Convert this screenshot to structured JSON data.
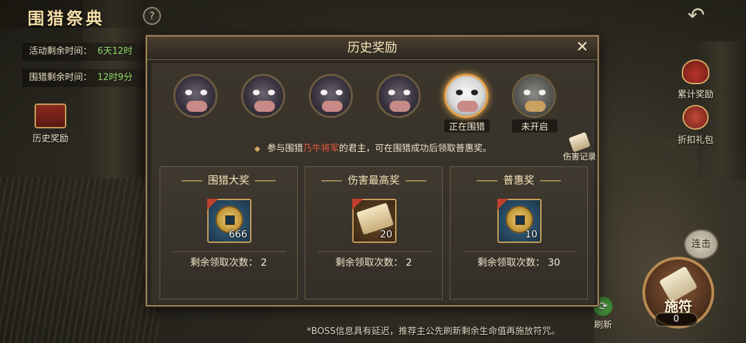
{
  "game": {
    "title": "围猎祭典",
    "help_label": "?",
    "back_label": "↶"
  },
  "info": [
    {
      "label": "活动剩余时间：",
      "value": "6天12时"
    },
    {
      "label": "围猎剩余时间：",
      "value": "12时9分"
    }
  ],
  "left_icons": {
    "history_label": "历史奖励"
  },
  "right_icons": {
    "cumulative_label": "累计奖励",
    "discount_label": "折扣礼包"
  },
  "controls": {
    "combo_label": "连击",
    "spell_label": "施符",
    "spell_count": "0",
    "refresh_label": "刷新"
  },
  "footer_note": "*BOSS信息具有延迟，推荐主公先刷新剩余生命值再施放符咒。",
  "dialog": {
    "title": "历史奖励",
    "close_label": "✕",
    "bosses": [
      {
        "status": "defeated",
        "label": ""
      },
      {
        "status": "defeated",
        "label": ""
      },
      {
        "status": "defeated",
        "label": ""
      },
      {
        "status": "defeated",
        "label": ""
      },
      {
        "status": "active",
        "label": "正在围猎"
      },
      {
        "status": "locked",
        "label": "未开启"
      }
    ],
    "desc_pre": "参与围猎",
    "desc_name": "乃牛将军",
    "desc_post": "的君主，可在围猎成功后领取普惠奖。",
    "desc_dot": "◆",
    "damage_record_label": "伤害记录",
    "remain_label": "剩余领取次数：",
    "cards": [
      {
        "title": "围猎大奖",
        "item": "coin",
        "qty": "666",
        "remain": "2"
      },
      {
        "title": "伤害最高奖",
        "item": "scroll",
        "qty": "20",
        "remain": "2"
      },
      {
        "title": "普惠奖",
        "item": "coin",
        "qty": "10",
        "remain": "30"
      }
    ]
  },
  "colors": {
    "highlight": "#e85a3a",
    "timer": "#8fd66a",
    "gold": "#c9a05a"
  }
}
